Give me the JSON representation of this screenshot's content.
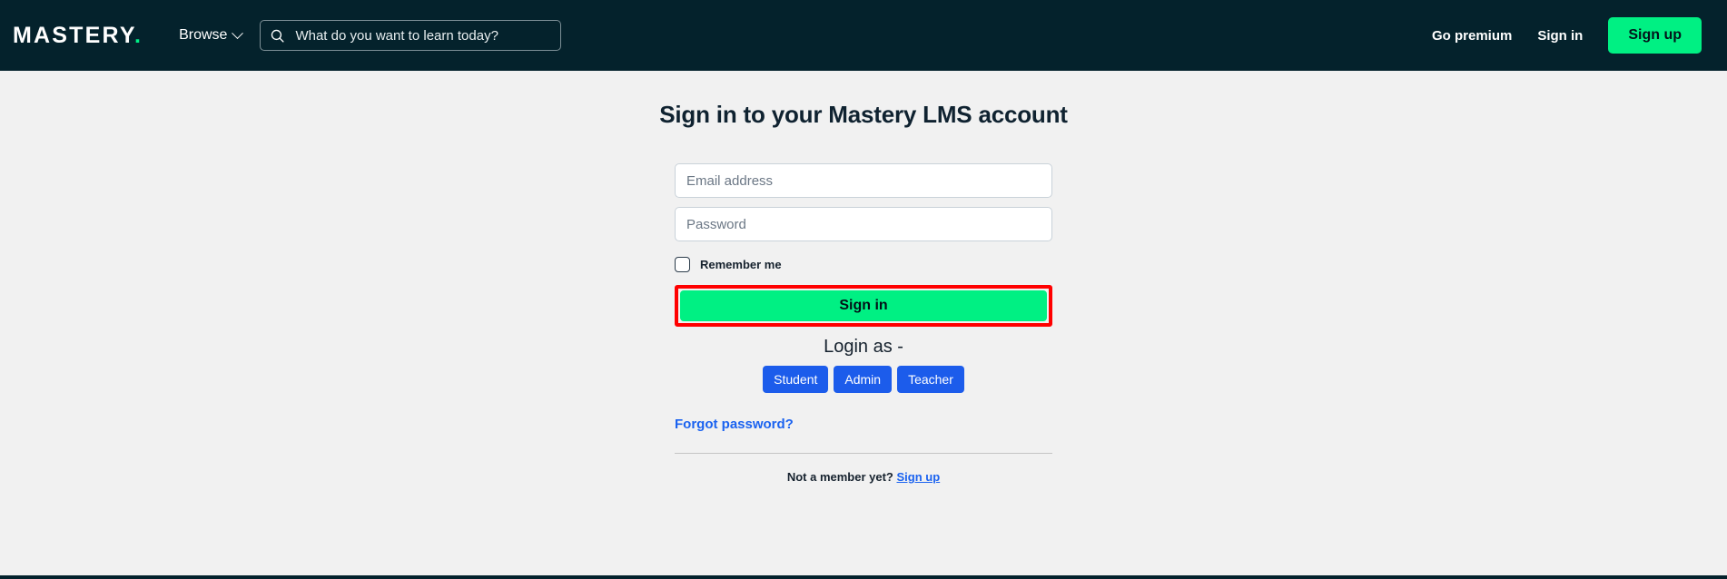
{
  "header": {
    "logo_text": "MASTERY",
    "logo_dot": ".",
    "browse_label": "Browse",
    "browse_chevron_icon": "chevron-down-icon",
    "search": {
      "icon": "search-icon",
      "placeholder": "What do you want to learn today?",
      "value": ""
    },
    "go_premium_label": "Go premium",
    "sign_in_label": "Sign in",
    "sign_up_label": "Sign up",
    "background_color": "#04222c",
    "accent_color": "#00f083"
  },
  "main": {
    "page_title": "Sign in to your Mastery LMS account",
    "email": {
      "placeholder": "Email address",
      "value": ""
    },
    "password": {
      "placeholder": "Password",
      "value": ""
    },
    "remember_me_label": "Remember me",
    "remember_me_checked": false,
    "sign_in_button_label": "Sign in",
    "sign_in_button_color": "#00f083",
    "highlight_color": "#ff0000",
    "login_as_label": "Login as -",
    "roles": [
      {
        "label": "Student"
      },
      {
        "label": "Admin"
      },
      {
        "label": "Teacher"
      }
    ],
    "role_button_color": "#1c5ceb",
    "forgot_password_label": "Forgot password?",
    "member_prompt": "Not a member yet?",
    "member_signup_label": "Sign up",
    "link_color": "#1a62f0"
  },
  "page": {
    "background_color": "#f1f1f1"
  }
}
